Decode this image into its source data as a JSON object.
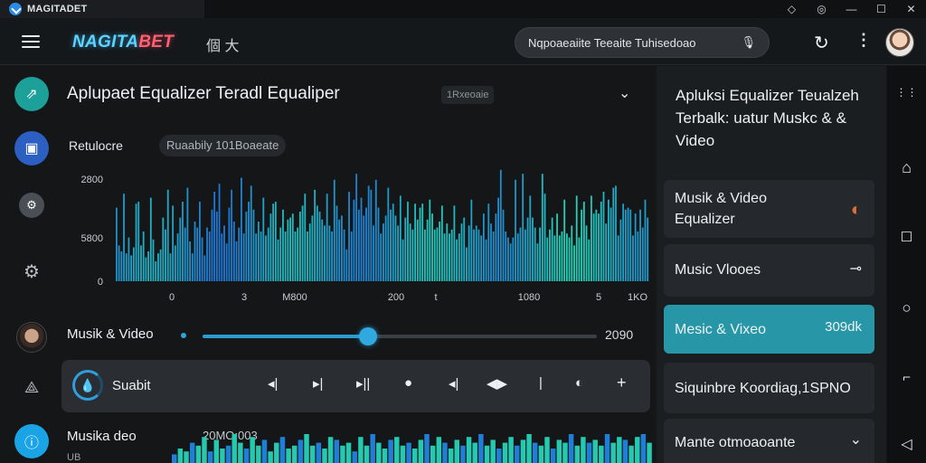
{
  "window": {
    "title": "MAGITADET",
    "controls": [
      "◇",
      "◎",
      "—",
      "☐",
      "✕"
    ]
  },
  "appbar": {
    "brand_part1": "NAGITA",
    "brand_part2": "BET",
    "lang": "個 大",
    "search_placeholder": "Nqpoaeaiite Teeaite Tuhisedoao",
    "mic": "🎙",
    "refresh": "↻",
    "more": "⋮"
  },
  "main": {
    "title": "Aplupaet Equalizer Teradl Equaliper",
    "title_chip": "1Rxeoaie",
    "collapse_icon": "⌄",
    "subtitle_label": "Retulocre",
    "subtitle_chip": "Ruaabily 101Boaeate",
    "music_row": {
      "label": "Musik & Video",
      "value": "2090",
      "level_percent": 42
    },
    "player": {
      "label": "Suabit",
      "controls": [
        "◂|",
        "▸|",
        "▸||",
        "●",
        "◂|",
        "◀▶",
        "|",
        "◐",
        "+"
      ]
    },
    "bottom_row": {
      "label": "Musika deo",
      "stamp": "20MO:003",
      "sub": "UB"
    }
  },
  "chart_data": {
    "type": "bar",
    "title": "",
    "y_ticks": [
      "2800",
      "5800",
      "0"
    ],
    "x_ticks": [
      "0",
      "3",
      "M800",
      "200",
      "t",
      "1080",
      "5",
      "1KO"
    ],
    "ylim": [
      0,
      3000
    ],
    "colors": {
      "low": "#1f6fd6",
      "high": "#23d7b6"
    },
    "values": [
      1850,
      900,
      750,
      2200,
      700,
      1100,
      650,
      850,
      1950,
      2000,
      900,
      1250,
      600,
      750,
      2100,
      1050,
      500,
      700,
      800,
      1600,
      1300,
      2300,
      700,
      1900,
      900,
      1200,
      1600,
      2000,
      1350,
      2350,
      1000,
      700,
      1500,
      1350,
      2000,
      1100,
      650,
      1350,
      1250,
      1800,
      2250,
      1750,
      2450,
      1200,
      1400,
      950,
      1850,
      2300,
      1500,
      1000,
      1350,
      2600,
      1200,
      1750,
      2000,
      2400,
      1800,
      1200,
      1500,
      1250,
      2100,
      1150,
      1350,
      1700,
      1950,
      2000,
      1050,
      1350,
      1800,
      1250,
      1550,
      1600,
      1700,
      1250,
      1350,
      1750,
      1900,
      2200,
      1250,
      1450,
      1650,
      2300,
      1900,
      1750,
      1550,
      1400,
      2200,
      1400,
      1250,
      2550,
      1900,
      1550,
      1650,
      1300,
      800,
      2250,
      1250,
      2050,
      2700,
      1800,
      2100,
      1650,
      1850,
      2400,
      2300,
      1400,
      2550,
      1850,
      1200,
      1450,
      1650,
      2350,
      1800,
      1950,
      1650,
      1400,
      2150,
      1050,
      1600,
      2000,
      1450,
      1300,
      1950,
      1550,
      1850,
      1950,
      1300,
      1550,
      2050,
      1700,
      1300,
      1350,
      1500,
      1900,
      1200,
      1450,
      1200,
      1300,
      1900,
      1050,
      1200,
      1450,
      1600,
      850,
      1400,
      2050,
      1300,
      1400,
      1300,
      1150,
      1700,
      1050,
      1950,
      1450,
      1250,
      1700,
      2100,
      2800,
      1800,
      1250,
      1100,
      950,
      1100,
      2550,
      1200,
      1350,
      2700,
      1300,
      1600,
      2150,
      1600,
      1350,
      950,
      1350,
      2700,
      2200,
      1100,
      1300,
      1600,
      1150,
      1700,
      1150,
      1250,
      2050,
      1200,
      1100,
      1400,
      900,
      2150,
      1100,
      1800,
      2000,
      1400,
      1050,
      2150,
      1700,
      1800,
      1700,
      2000,
      2250,
      1450,
      2050,
      1850,
      2350,
      2400,
      1150,
      1550,
      1950,
      1800,
      1850,
      1800,
      1150,
      1700,
      1250,
      1800,
      1350,
      2050,
      1600
    ]
  },
  "mini_wave": [
    0.3,
    0.5,
    0.4,
    0.7,
    0.6,
    0.9,
    0.4,
    0.8,
    0.5,
    0.6,
    1.0,
    0.7,
    0.5,
    0.9,
    0.6,
    0.8,
    0.4,
    0.7,
    0.9,
    0.5,
    0.6,
    0.8,
    1.0,
    0.6,
    0.7,
    0.5,
    0.9,
    0.8,
    0.6,
    0.7,
    0.4,
    0.9,
    0.6,
    1.0,
    0.7,
    0.5,
    0.8,
    0.9,
    0.6,
    0.7,
    0.5,
    0.8,
    1.0,
    0.6,
    0.9,
    0.7,
    0.5,
    0.8,
    0.6,
    0.9,
    0.7,
    1.0,
    0.6,
    0.8,
    0.5,
    0.7,
    0.9,
    0.6,
    0.8,
    1.0,
    0.7,
    0.6,
    0.9,
    0.5,
    0.8,
    0.7,
    1.0,
    0.6,
    0.9,
    0.7,
    0.8,
    0.6,
    1.0,
    0.7,
    0.9,
    0.8,
    0.6,
    0.9,
    1.0,
    0.7
  ],
  "right_panel": {
    "heading": "Apluksi Equalizer Teualzeh Terbalk: uatur Muskc & & Video",
    "cards": [
      {
        "label": "Musik & Video Equalizer",
        "icon": "◐"
      },
      {
        "label": "Music Vlooes",
        "icon": "⊸"
      },
      {
        "label": "Mesic & Vixeo",
        "value": "309dk"
      },
      {
        "label": "Siquinbre Koordiag,1SPNO"
      },
      {
        "label": "Mante otmoaoante",
        "icon": "⌄"
      }
    ]
  },
  "navbar": {
    "icons": [
      "⋮⋮",
      "⌂",
      "☐",
      "○",
      "⌐",
      "◁"
    ]
  },
  "rail": {
    "icons": [
      "⇗",
      "▣",
      "⚙",
      "⚙",
      "⟁"
    ]
  }
}
